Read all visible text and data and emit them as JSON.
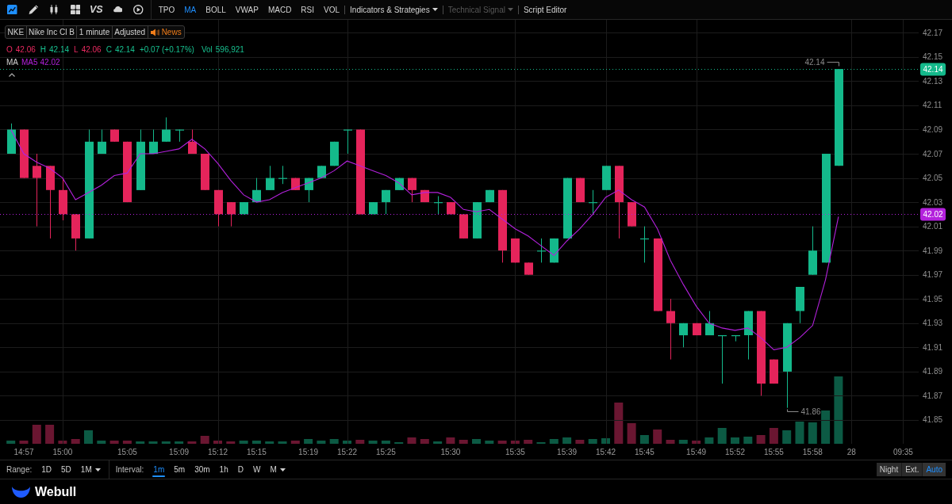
{
  "toolbar": {
    "tools": [
      {
        "kind": "icon",
        "selected": true
      },
      {
        "kind": "icon",
        "selected": false
      },
      {
        "kind": "icon",
        "selected": false
      },
      {
        "kind": "icon",
        "selected": false
      },
      {
        "kind": "text",
        "label": "VS",
        "selected": false
      },
      {
        "kind": "icon",
        "selected": false
      },
      {
        "kind": "icon",
        "selected": false
      }
    ],
    "indicators": [
      {
        "label": "TPO",
        "selected": false
      },
      {
        "label": "MA",
        "selected": true
      },
      {
        "label": "BOLL",
        "selected": false
      },
      {
        "label": "VWAP",
        "selected": false
      },
      {
        "label": "MACD",
        "selected": false
      },
      {
        "label": "RSI",
        "selected": false
      },
      {
        "label": "VOL",
        "selected": false
      }
    ],
    "menus": [
      {
        "label": "Indicators & Strategies",
        "dropdown": true,
        "disabled": false
      },
      {
        "label": "Technical Signal",
        "dropdown": true,
        "disabled": true
      },
      {
        "label": "Script Editor",
        "dropdown": false,
        "disabled": false
      }
    ]
  },
  "legend": {
    "symbol": "NKE",
    "name": "Nike Inc Cl B",
    "interval": "1 minute",
    "adjustment": "Adjusted",
    "news": "News"
  },
  "quote": {
    "fields": [
      {
        "label": "O",
        "value": "42.06",
        "rising": false
      },
      {
        "label": "H",
        "value": "42.14",
        "rising": true
      },
      {
        "label": "L",
        "value": "42.06",
        "rising": false
      },
      {
        "label": "C",
        "value": "42.14",
        "rising": true
      }
    ],
    "change": "+0.07 (+0.17%)",
    "change_rising": true,
    "volume_label": "Vol",
    "volume": "596,921"
  },
  "ma_legend": {
    "label": "MA",
    "value": "42.02",
    "expanded": true
  },
  "chart": {
    "chart_data": {
      "type": "candlestick",
      "categories": [
        null,
        "14:57",
        null,
        null,
        "15:00",
        null,
        null,
        null,
        null,
        "15:05",
        null,
        null,
        null,
        "15:09",
        null,
        null,
        "15:12",
        null,
        null,
        "15:15",
        null,
        null,
        null,
        "15:19",
        null,
        null,
        "15:22",
        null,
        null,
        "15:25",
        null,
        null,
        null,
        null,
        "15:30",
        null,
        null,
        null,
        null,
        "15:35",
        null,
        null,
        null,
        "15:39",
        null,
        null,
        "15:42",
        null,
        null,
        "15:45",
        null,
        null,
        null,
        "15:49",
        null,
        null,
        "15:52",
        null,
        null,
        "15:55",
        null,
        null,
        "15:58",
        null,
        null,
        "28",
        null,
        null,
        null,
        "09:35"
      ],
      "ohlc": [
        [
          42.07,
          42.095,
          42.07,
          42.09
        ],
        [
          42.09,
          42.09,
          42.05,
          42.05
        ],
        [
          42.06,
          42.07,
          42.01,
          42.05
        ],
        [
          42.06,
          42.06,
          42.0,
          42.04
        ],
        [
          42.04,
          42.05,
          42.015,
          42.02
        ],
        [
          42.02,
          42.02,
          41.99,
          42.0
        ],
        [
          42.0,
          42.09,
          42.0,
          42.08
        ],
        [
          42.07,
          42.09,
          42.07,
          42.08
        ],
        [
          42.09,
          42.09,
          42.08,
          42.08
        ],
        [
          42.08,
          42.08,
          42.03,
          42.03
        ],
        [
          42.04,
          42.09,
          42.04,
          42.08
        ],
        [
          42.07,
          42.09,
          42.07,
          42.08
        ],
        [
          42.08,
          42.1,
          42.08,
          42.09
        ],
        [
          42.09,
          42.09,
          42.08,
          42.09
        ],
        [
          42.08,
          42.09,
          42.07,
          42.07
        ],
        [
          42.07,
          42.07,
          42.04,
          42.04
        ],
        [
          42.04,
          42.04,
          42.01,
          42.02
        ],
        [
          42.03,
          42.03,
          42.01,
          42.02
        ],
        [
          42.02,
          42.03,
          42.02,
          42.03
        ],
        [
          42.03,
          42.05,
          42.03,
          42.04
        ],
        [
          42.04,
          42.06,
          42.04,
          42.05
        ],
        [
          42.05,
          42.06,
          42.045,
          42.05
        ],
        [
          42.05,
          42.05,
          42.04,
          42.04
        ],
        [
          42.04,
          42.05,
          42.03,
          42.05
        ],
        [
          42.05,
          42.06,
          42.05,
          42.06
        ],
        [
          42.06,
          42.08,
          42.06,
          42.08
        ],
        [
          42.09,
          42.09,
          42.07,
          42.09
        ],
        [
          42.09,
          42.09,
          42.02,
          42.02
        ],
        [
          42.02,
          42.03,
          42.02,
          42.03
        ],
        [
          42.03,
          42.04,
          42.02,
          42.04
        ],
        [
          42.04,
          42.05,
          42.04,
          42.05
        ],
        [
          42.05,
          42.05,
          42.03,
          42.04
        ],
        [
          42.04,
          42.04,
          42.03,
          42.03
        ],
        [
          42.03,
          42.035,
          42.02,
          42.03
        ],
        [
          42.03,
          42.03,
          42.02,
          42.02
        ],
        [
          42.02,
          42.02,
          42.0,
          42.0
        ],
        [
          42.0,
          42.03,
          42.0,
          42.03
        ],
        [
          42.03,
          42.04,
          42.03,
          42.04
        ],
        [
          42.04,
          42.04,
          41.98,
          41.99
        ],
        [
          42.0,
          42.0,
          41.98,
          41.98
        ],
        [
          41.98,
          41.98,
          41.97,
          41.97
        ],
        [
          41.99,
          42.0,
          41.98,
          41.99
        ],
        [
          41.98,
          42.0,
          41.98,
          42.0
        ],
        [
          42.0,
          42.05,
          42.0,
          42.05
        ],
        [
          42.05,
          42.05,
          42.03,
          42.03
        ],
        [
          42.03,
          42.04,
          42.02,
          42.03
        ],
        [
          42.04,
          42.06,
          42.04,
          42.06
        ],
        [
          42.06,
          42.06,
          42.0,
          42.03
        ],
        [
          42.03,
          42.03,
          42.01,
          42.01
        ],
        [
          42.0,
          42.01,
          41.98,
          42.0
        ],
        [
          42.0,
          42.0,
          41.94,
          41.94
        ],
        [
          41.94,
          41.95,
          41.9,
          41.93
        ],
        [
          41.92,
          41.93,
          41.91,
          41.93
        ],
        [
          41.93,
          41.93,
          41.92,
          41.92
        ],
        [
          41.92,
          41.94,
          41.92,
          41.93
        ],
        [
          41.92,
          41.92,
          41.88,
          41.92
        ],
        [
          41.92,
          41.92,
          41.915,
          41.92
        ],
        [
          41.92,
          41.94,
          41.9,
          41.94
        ],
        [
          41.94,
          41.94,
          41.87,
          41.88
        ],
        [
          41.9,
          41.9,
          41.88,
          41.88
        ],
        [
          41.89,
          41.93,
          41.86,
          41.93
        ],
        [
          41.94,
          41.96,
          41.93,
          41.96
        ],
        [
          41.97,
          42.01,
          41.97,
          41.99
        ],
        [
          41.98,
          42.07,
          41.98,
          42.07
        ],
        [
          42.06,
          42.14,
          42.06,
          42.14
        ],
        null,
        null,
        null,
        null,
        null
      ],
      "series": [
        {
          "name": "MA5",
          "type": "line",
          "color": "#b321dc",
          "values": [
            42.09,
            42.07,
            42.063,
            42.058,
            42.05,
            42.032,
            42.038,
            42.044,
            42.052,
            42.054,
            42.07,
            42.07,
            42.072,
            42.074,
            42.082,
            42.074,
            42.062,
            42.048,
            42.036,
            42.03,
            42.032,
            42.038,
            42.042,
            42.046,
            42.05,
            42.056,
            42.064,
            42.06,
            42.056,
            42.052,
            42.046,
            42.036,
            42.038,
            42.038,
            42.034,
            42.024,
            42.022,
            42.024,
            42.016,
            42.008,
            42.002,
            41.994,
            41.986,
            41.998,
            42.008,
            42.02,
            42.034,
            42.04,
            42.032,
            42.026,
            42.008,
            41.982,
            41.962,
            41.944,
            41.93,
            41.926,
            41.924,
            41.926,
            41.918,
            41.908,
            41.91,
            41.918,
            41.928,
            41.966,
            42.018,
            null,
            null,
            null,
            null,
            null
          ]
        }
      ],
      "ref_lines": [
        {
          "axis": "y",
          "value": 42.14,
          "label": "42.14",
          "color": "#14b98b"
        },
        {
          "axis": "y",
          "value": 42.02,
          "label": "42.02",
          "color": "#b321dc"
        }
      ],
      "ylim": [
        41.8303,
        42.1807
      ],
      "yticks": [
        42.17,
        42.15,
        42.13,
        42.11,
        42.09,
        42.07,
        42.05,
        42.03,
        42.01,
        41.99,
        41.97,
        41.95,
        41.93,
        41.91,
        41.89,
        41.87,
        41.85
      ],
      "grid": true
    },
    "high_label": "42.14",
    "low_label": "41.86"
  },
  "range_bar": {
    "range_label": "Range:",
    "ranges": [
      {
        "label": "1D",
        "selected": false,
        "dropdown": false
      },
      {
        "label": "5D",
        "selected": false,
        "dropdown": false
      },
      {
        "label": "1M",
        "selected": false,
        "dropdown": true
      }
    ],
    "interval_label": "Interval:",
    "intervals": [
      {
        "label": "1m",
        "selected": true,
        "dropdown": false
      },
      {
        "label": "5m",
        "selected": false,
        "dropdown": false
      },
      {
        "label": "30m",
        "selected": false,
        "dropdown": false
      },
      {
        "label": "1h",
        "selected": false,
        "dropdown": false
      },
      {
        "label": "D",
        "selected": false,
        "dropdown": false
      },
      {
        "label": "W",
        "selected": false,
        "dropdown": false
      },
      {
        "label": "M",
        "selected": false,
        "dropdown": true
      }
    ],
    "sessions": [
      {
        "label": "Night",
        "selected": false
      },
      {
        "label": "Ext.",
        "selected": false
      },
      {
        "label": "Auto",
        "selected": true
      }
    ]
  },
  "footer": {
    "brand": "Webull"
  }
}
